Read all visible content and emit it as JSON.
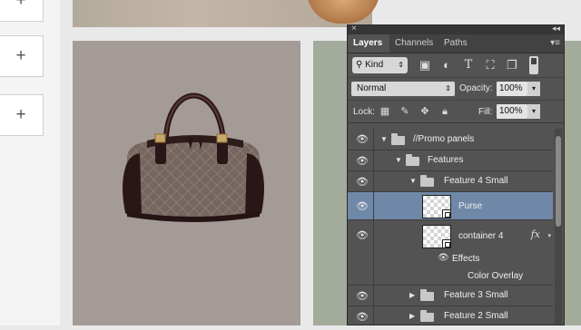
{
  "canvas": {
    "add_buttons": [
      "+",
      "+",
      "+"
    ],
    "product_image_alt": "Purse"
  },
  "panel": {
    "close_glyph": "×",
    "collapse_glyph": "◂◂",
    "tabs": [
      {
        "label": "Layers",
        "active": true
      },
      {
        "label": "Channels",
        "active": false
      },
      {
        "label": "Paths",
        "active": false
      }
    ],
    "menu_glyph": "▾≡",
    "filter": {
      "kind_label": "Kind",
      "icons": [
        "image-filter-icon",
        "adjustment-filter-icon",
        "type-filter-icon",
        "shape-filter-icon",
        "smart-object-filter-icon"
      ]
    },
    "blend_mode": "Normal",
    "opacity_label": "Opacity:",
    "opacity_value": "100%",
    "lock_label": "Lock:",
    "fill_label": "Fill:",
    "fill_value": "100%",
    "layers": [
      {
        "name": "//Promo panels",
        "type": "group",
        "expanded": true,
        "indent": 0,
        "visible": true
      },
      {
        "name": "Features",
        "type": "group",
        "expanded": true,
        "indent": 1,
        "visible": true
      },
      {
        "name": "Feature 4 Small",
        "type": "group",
        "expanded": true,
        "indent": 2,
        "visible": true
      },
      {
        "name": "Purse",
        "type": "smart-object",
        "indent": 3,
        "visible": true,
        "selected": true
      },
      {
        "name": "container 4",
        "type": "smart-object",
        "indent": 3,
        "visible": true,
        "fx": "fx"
      },
      {
        "name": "Effects",
        "type": "effects",
        "indent": 3,
        "visible": true
      },
      {
        "name": "Color Overlay",
        "type": "effect-item",
        "indent": 4
      },
      {
        "name": "Feature 3 Small",
        "type": "group",
        "expanded": false,
        "indent": 2,
        "visible": true
      },
      {
        "name": "Feature 2 Small",
        "type": "group",
        "expanded": false,
        "indent": 2,
        "visible": true
      }
    ]
  },
  "colors": {
    "panel_bg": "#535353",
    "selection": "#6f88a7",
    "tan_panel": "#a59b96",
    "green_panel": "#a3ab9b"
  }
}
